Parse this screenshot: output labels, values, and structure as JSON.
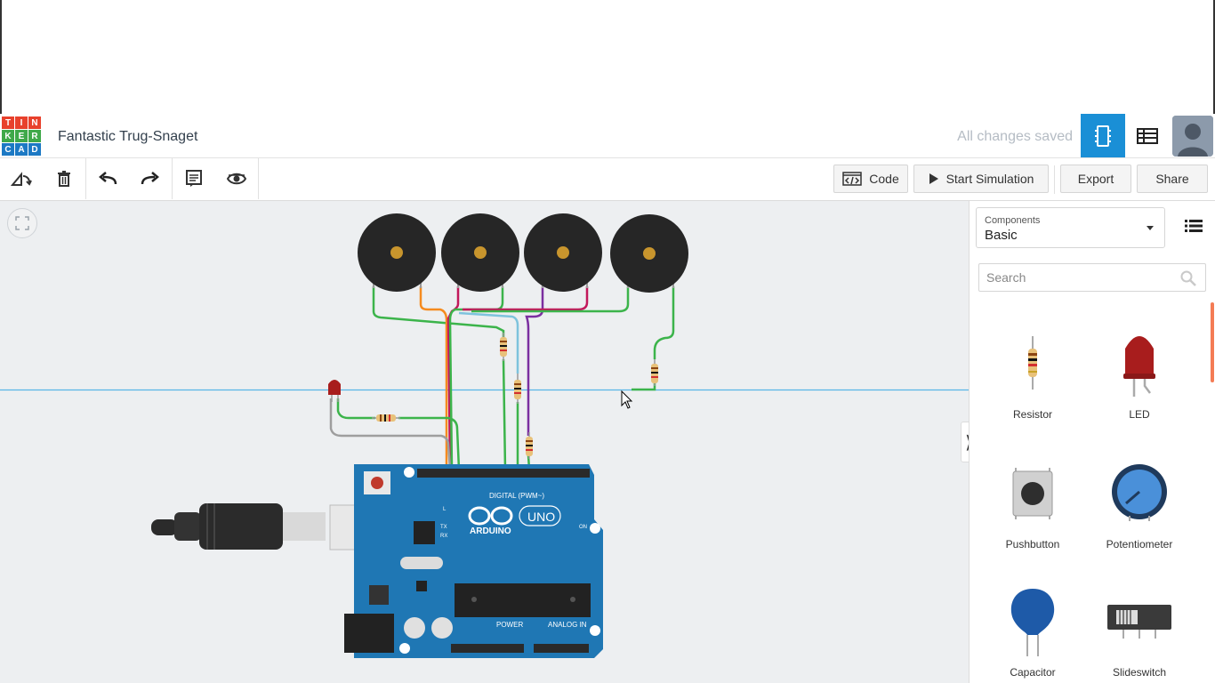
{
  "app": {
    "logo_letters": [
      "T",
      "I",
      "N",
      "K",
      "E",
      "R",
      "C",
      "A",
      "D"
    ],
    "logo_colors": [
      "#e8412c",
      "#e8412c",
      "#e8412c",
      "#3fa94a",
      "#3fa94a",
      "#3fa94a",
      "#1c79c4",
      "#1c79c4",
      "#1c79c4"
    ],
    "project_title": "Fantastic Trug-Snaget",
    "save_status": "All changes saved",
    "accent": "#1a8fd6"
  },
  "toolbar": {
    "code_label": "Code",
    "simulate_label": "Start Simulation",
    "export_label": "Export",
    "share_label": "Share",
    "tools": [
      "rotate-icon",
      "trash-icon",
      "undo-icon",
      "redo-icon",
      "notes-icon",
      "visibility-icon"
    ]
  },
  "canvas": {
    "board_brand": "ARDUINO",
    "board_model": "UNO",
    "digital_label": "DIGITAL (PWM~)",
    "power_label": "POWER",
    "analog_label": "ANALOG IN",
    "on_label": "ON",
    "tx_label": "TX",
    "rx_label": "RX",
    "l_label": "L"
  },
  "panel": {
    "components_label": "Components",
    "components_value": "Basic",
    "search_placeholder": "Search",
    "items": [
      {
        "name": "Resistor"
      },
      {
        "name": "LED"
      },
      {
        "name": "Pushbutton"
      },
      {
        "name": "Potentiometer"
      },
      {
        "name": "Capacitor"
      },
      {
        "name": "Slideswitch"
      }
    ]
  }
}
